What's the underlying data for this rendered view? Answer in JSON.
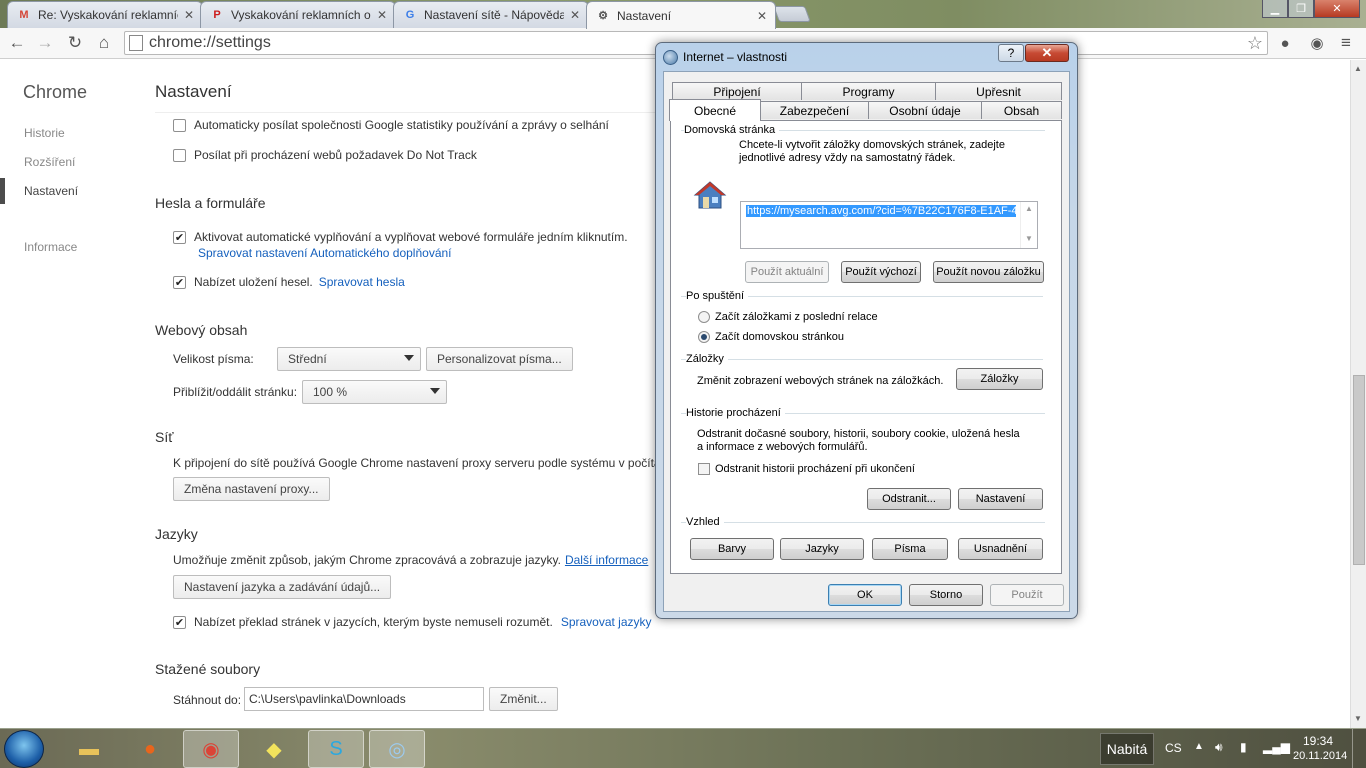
{
  "browser": {
    "tabs": [
      {
        "title": "Re: Vyskakování reklamníc",
        "icon": "M",
        "icon_color": "#d44638"
      },
      {
        "title": "Vyskakování reklamních o",
        "icon": "P",
        "icon_color": "#cc1d1d"
      },
      {
        "title": "Nastavení sítě - Nápověda",
        "icon": "G",
        "icon_color": "#3b7de8"
      },
      {
        "title": "Nastavení",
        "icon": "⚙",
        "icon_color": "#555555"
      }
    ],
    "url": "chrome://settings"
  },
  "settings": {
    "brand": "Chrome",
    "nav": [
      "Historie",
      "Rozšíření",
      "Nastavení",
      "Informace"
    ],
    "page_title": "Nastavení",
    "privacy": {
      "stats": "Automaticky posílat společnosti Google statistiky používání a zprávy o selhání",
      "dnt": "Posílat při procházení webů požadavek Do Not Track"
    },
    "passwords": {
      "heading": "Hesla a formuláře",
      "autofill": "Aktivovat automatické vyplňování a vyplňovat webové formuláře jedním kliknutím.",
      "autofill_link": "Spravovat nastavení Automatického doplňování",
      "save_pw": "Nabízet uložení hesel.",
      "save_pw_link": "Spravovat hesla"
    },
    "web": {
      "heading": "Webový obsah",
      "font_label": "Velikost písma:",
      "font_value": "Střední",
      "font_btn": "Personalizovat písma...",
      "zoom_label": "Přiblížit/oddálit stránku:",
      "zoom_value": "100 %"
    },
    "network": {
      "heading": "Síť",
      "desc": "K připojení do sítě používá Google Chrome nastavení proxy serveru podle systému v počíta",
      "btn": "Změna nastavení proxy..."
    },
    "languages": {
      "heading": "Jazyky",
      "desc": "Umožňuje změnit způsob, jakým Chrome zpracovává a zobrazuje jazyky.",
      "desc_link": "Další informace",
      "btn": "Nastavení jazyka a zadávání údajů...",
      "translate": "Nabízet překlad stránek v jazycích, kterým byste nemuseli rozumět.",
      "translate_link": "Spravovat jazyky"
    },
    "downloads": {
      "heading": "Stažené soubory",
      "label": "Stáhnout do:",
      "path": "C:\\Users\\pavlinka\\Downloads",
      "btn": "Změnit..."
    }
  },
  "dialog": {
    "title": "Internet – vlastnosti",
    "help": "?",
    "close": "✕",
    "tabs_back": [
      "Připojení",
      "Programy",
      "Upřesnit"
    ],
    "tabs_front": [
      "Obecné",
      "Zabezpečení",
      "Osobní údaje",
      "Obsah"
    ],
    "home": {
      "group": "Domovská stránka",
      "desc1": "Chcete-li vytvořit záložky domovských stránek, zadejte",
      "desc2": "jednotlivé adresy vždy na samostatný řádek.",
      "url": "https://mysearch.avg.com/?cid=%7B22C176F8-E1AF-4",
      "btn_current": "Použít aktuální",
      "btn_default": "Použít výchozí",
      "btn_newtab": "Použít novou záložku"
    },
    "startup": {
      "group": "Po spuštění",
      "opt1": "Začít záložkami z poslední relace",
      "opt2": "Začít domovskou stránkou"
    },
    "tabs_grp": {
      "group": "Záložky",
      "desc": "Změnit zobrazení webových stránek na záložkách.",
      "btn": "Záložky"
    },
    "history": {
      "group": "Historie procházení",
      "desc1": "Odstranit dočasné soubory, historii, soubory cookie, uložená hesla",
      "desc2": "a informace z webových formulářů.",
      "chk": "Odstranit historii procházení při ukončení",
      "btn_delete": "Odstranit...",
      "btn_settings": "Nastavení"
    },
    "look": {
      "group": "Vzhled",
      "btns": [
        "Barvy",
        "Jazyky",
        "Písma",
        "Usnadnění"
      ]
    },
    "ok": "OK",
    "cancel": "Storno",
    "apply": "Použít"
  },
  "taskbar": {
    "tray_label": "Nabitá",
    "lang": "CS",
    "time": "19:34",
    "date": "20.11.2014"
  }
}
